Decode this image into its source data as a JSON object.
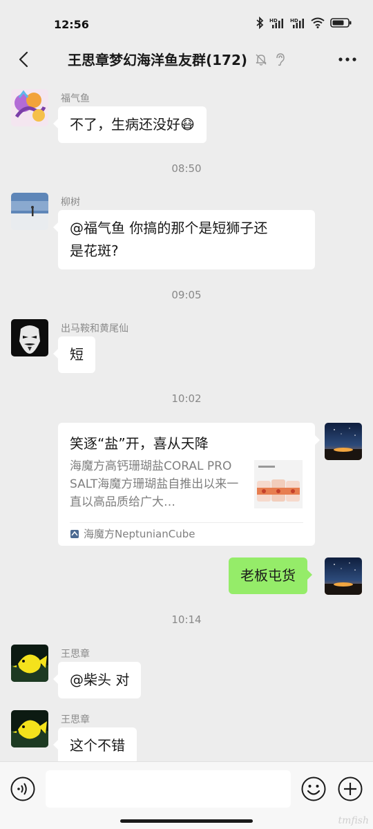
{
  "status_bar": {
    "time": "12:56"
  },
  "header": {
    "title": "王思章梦幻海洋鱼友群(172)"
  },
  "messages": [
    {
      "sender": "福气鱼",
      "text": "不了，生病还没好😷"
    },
    {
      "time": "08:50"
    },
    {
      "sender": "柳树",
      "text_line1": "@福气鱼  你搞的那个是短狮子还",
      "text_line2": "是花斑?"
    },
    {
      "time": "09:05"
    },
    {
      "sender": "出马鞍和黄尾仙",
      "text": "短"
    },
    {
      "time": "10:02"
    },
    {
      "card_title": "笑逐“盐”开，喜从天降",
      "card_desc": "海魔方高钙珊瑚盐CORAL PRO SALT海魔方珊瑚盐自推出以来一直以高品质给广大…",
      "card_source": "海魔方NeptunianCube"
    },
    {
      "text": "老板屯货"
    },
    {
      "time": "10:14"
    },
    {
      "sender": "王思章",
      "text": "@柴头  对"
    },
    {
      "sender": "王思章",
      "text": "这个不错"
    }
  ],
  "input": {
    "placeholder": ""
  },
  "watermark": "tmfish"
}
